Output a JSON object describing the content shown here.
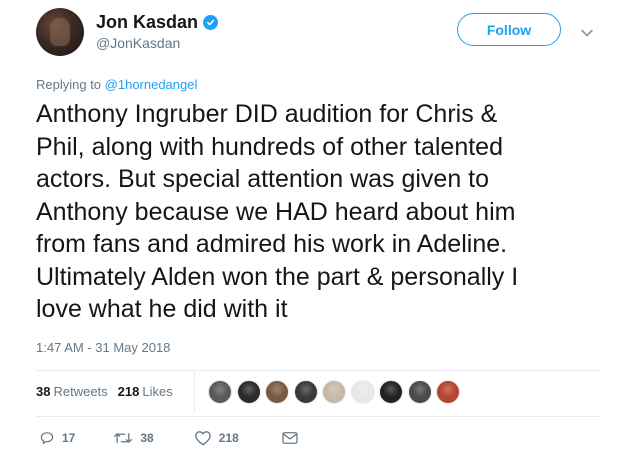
{
  "author": {
    "display_name": "Jon Kasdan",
    "handle": "@JonKasdan",
    "verified": true
  },
  "follow_button_label": "Follow",
  "reply_context": {
    "prefix": "Replying to ",
    "mention": "@1hornedangel"
  },
  "tweet_lines": [
    "Anthony Ingruber DID audition for Chris &",
    "Phil, along with hundreds of other talented",
    "actors. But special attention was given to",
    "Anthony because we HAD heard about him",
    "from fans and admired his work in Adeline.",
    "Ultimately Alden won the part & personally I",
    "love what he did with it"
  ],
  "timestamp": "1:47 AM - 31 May 2018",
  "stats": {
    "retweets_count": "38",
    "retweets_label": "Retweets",
    "likes_count": "218",
    "likes_label": "Likes"
  },
  "liker_avatar_colors": [
    "#5a5a5a",
    "#2b2b2b",
    "#7a5a44",
    "#3a3a3a",
    "#c9b8a4",
    "#e8e8e8",
    "#222222",
    "#4a4a4a",
    "#b5452e"
  ],
  "actions": {
    "reply_count": "17",
    "retweet_count": "38",
    "like_count": "218"
  },
  "colors": {
    "accent": "#1da1f2",
    "text": "#14171a",
    "muted": "#657786"
  }
}
